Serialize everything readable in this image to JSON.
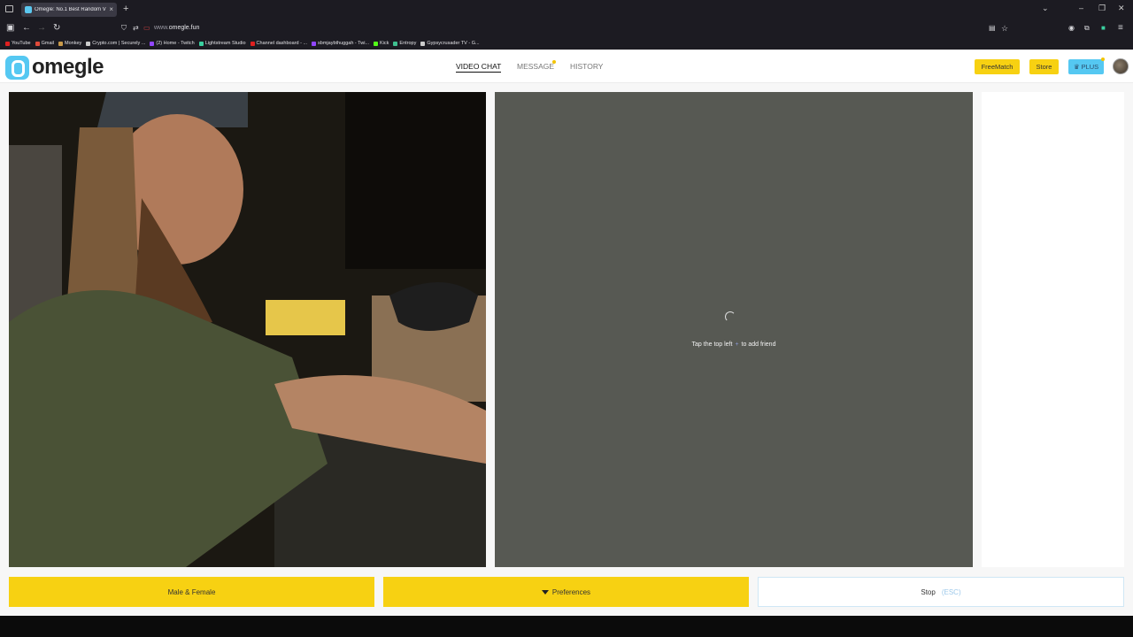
{
  "browser": {
    "tab_title": "Omegle: No.1 Best Random Vi",
    "url_prefix": "www.",
    "url_domain": "omegle.fun",
    "bookmarks": [
      {
        "label": "YouTube",
        "color": "#e02020"
      },
      {
        "label": "Gmail",
        "color": "#e04a3a"
      },
      {
        "label": "Monkey",
        "color": "#c99a4a"
      },
      {
        "label": "Crypto.com | Securely ...",
        "color": "#cccccc"
      },
      {
        "label": "(2) Home - Twitch",
        "color": "#9146ff"
      },
      {
        "label": "Lightstream Studio",
        "color": "#3ad0a0"
      },
      {
        "label": "Channel dashboard - ...",
        "color": "#e02020"
      },
      {
        "label": "sbmjaybthuggah - Twi...",
        "color": "#9146ff"
      },
      {
        "label": "Kick",
        "color": "#53fc18"
      },
      {
        "label": "Entropy",
        "color": "#40c090"
      },
      {
        "label": "Gypsycrusader TV - G...",
        "color": "#cccccc"
      }
    ]
  },
  "header": {
    "logo_text": "omegle",
    "nav": {
      "video_chat": "VIDEO CHAT",
      "message": "MESSAGE",
      "history": "HISTORY"
    },
    "free_match": "FreeMatch",
    "store": "Store",
    "plus": "PLUS",
    "plus_icon": "♛"
  },
  "main": {
    "spinner_icon": "loading-spinner",
    "hint_before": "Tap the top left",
    "hint_icon": "+",
    "hint_after": "to add friend"
  },
  "footer": {
    "gender": "Male & Female",
    "preferences": "Preferences",
    "stop": "Stop",
    "stop_timer": "(ESC)"
  },
  "colors": {
    "accent_yellow": "#f7d112",
    "plus_blue": "#55c8f2",
    "video_bg": "#575953"
  }
}
